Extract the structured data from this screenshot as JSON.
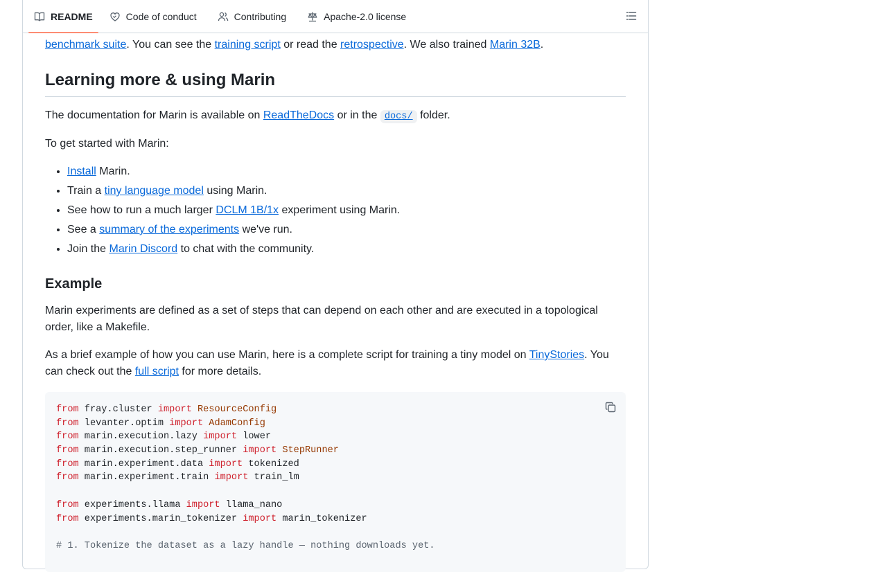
{
  "tabs": [
    {
      "label": "README",
      "icon": "book-icon",
      "active": true
    },
    {
      "label": "Code of conduct",
      "icon": "heart-icon"
    },
    {
      "label": "Contributing",
      "icon": "people-icon"
    },
    {
      "label": "Apache-2.0 license",
      "icon": "scale-icon"
    }
  ],
  "intro": {
    "hidden_link_partial": "benchmark suite",
    "segment1": ". You can see the ",
    "link_training_script": "training script",
    "segment2": " or read the ",
    "link_retrospective": "retrospective",
    "segment3": ". We also trained ",
    "link_marin32b": "Marin 32B",
    "segment4": "."
  },
  "learning": {
    "heading": "Learning more & using Marin",
    "docs_prefix": "The documentation for Marin is available on ",
    "docs_link": "ReadTheDocs",
    "docs_middle": " or in the ",
    "docs_code": "docs/",
    "docs_suffix": " folder.",
    "get_started": "To get started with Marin:",
    "steps": [
      {
        "pre": "",
        "link": "Install",
        "post": " Marin."
      },
      {
        "pre": "Train a ",
        "link": "tiny language model",
        "post": " using Marin."
      },
      {
        "pre": "See how to run a much larger ",
        "link": "DCLM 1B/1x",
        "post": " experiment using Marin."
      },
      {
        "pre": "See a ",
        "link": "summary of the experiments",
        "post": " we've run."
      },
      {
        "pre": "Join the ",
        "link": "Marin Discord",
        "post": " to chat with the community."
      }
    ]
  },
  "example": {
    "heading": "Example",
    "para1": "Marin experiments are defined as a set of steps that can depend on each other and are executed in a topological order, like a Makefile.",
    "para2_prefix": "As a brief example of how you can use Marin, here is a complete script for training a tiny model on ",
    "para2_link1": "TinyStories",
    "para2_middle": ". You can check out the ",
    "para2_link2": "full script",
    "para2_suffix": " for more details."
  },
  "code": {
    "lines": [
      [
        [
          "kw",
          "from"
        ],
        [
          "t",
          " fray.cluster "
        ],
        [
          "kw",
          "import"
        ],
        [
          "t",
          " "
        ],
        [
          "cls",
          "ResourceConfig"
        ]
      ],
      [
        [
          "kw",
          "from"
        ],
        [
          "t",
          " levanter.optim "
        ],
        [
          "kw",
          "import"
        ],
        [
          "t",
          " "
        ],
        [
          "cls",
          "AdamConfig"
        ]
      ],
      [
        [
          "kw",
          "from"
        ],
        [
          "t",
          " marin.execution.lazy "
        ],
        [
          "kw",
          "import"
        ],
        [
          "t",
          " lower"
        ]
      ],
      [
        [
          "kw",
          "from"
        ],
        [
          "t",
          " marin.execution.step_runner "
        ],
        [
          "kw",
          "import"
        ],
        [
          "t",
          " "
        ],
        [
          "cls",
          "StepRunner"
        ]
      ],
      [
        [
          "kw",
          "from"
        ],
        [
          "t",
          " marin.experiment.data "
        ],
        [
          "kw",
          "import"
        ],
        [
          "t",
          " tokenized"
        ]
      ],
      [
        [
          "kw",
          "from"
        ],
        [
          "t",
          " marin.experiment.train "
        ],
        [
          "kw",
          "import"
        ],
        [
          "t",
          " train_lm"
        ]
      ],
      [],
      [
        [
          "kw",
          "from"
        ],
        [
          "t",
          " experiments.llama "
        ],
        [
          "kw",
          "import"
        ],
        [
          "t",
          " llama_nano"
        ]
      ],
      [
        [
          "kw",
          "from"
        ],
        [
          "t",
          " experiments.marin_tokenizer "
        ],
        [
          "kw",
          "import"
        ],
        [
          "t",
          " marin_tokenizer"
        ]
      ],
      [],
      [
        [
          "cmt",
          "# 1. Tokenize the dataset as a lazy handle — nothing downloads yet."
        ]
      ]
    ]
  },
  "colors": {
    "link": "#0969da",
    "keyword": "#cf222e",
    "class_name": "#953800",
    "comment": "#59636e",
    "active_tab_underline": "#fd8c73"
  }
}
